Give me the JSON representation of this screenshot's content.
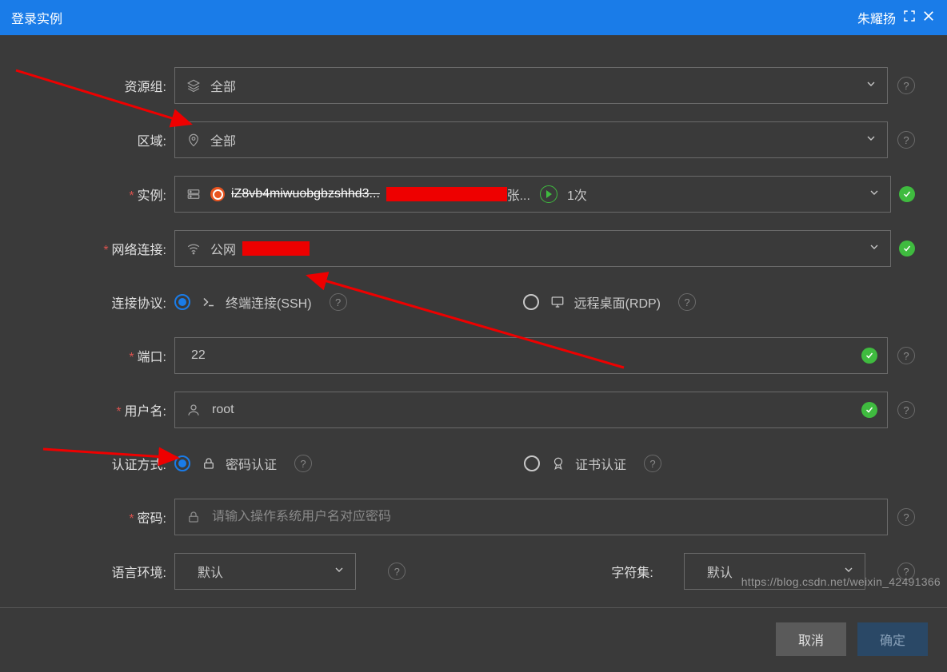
{
  "titlebar": {
    "title": "登录实例",
    "username": "朱耀扬"
  },
  "form": {
    "resource_group": {
      "label": "资源组:",
      "value": "全部"
    },
    "region": {
      "label": "区域:",
      "value": "全部"
    },
    "instance": {
      "label": "实例:",
      "text": "iZ8vb4miwuobgbzshhd3...",
      "suffix": "张...",
      "times": "1次"
    },
    "network": {
      "label": "网络连接:",
      "value": "公网"
    },
    "protocol": {
      "label": "连接协议:",
      "ssh": "终端连接(SSH)",
      "rdp": "远程桌面(RDP)"
    },
    "port": {
      "label": "端口:",
      "value": "22"
    },
    "username": {
      "label": "用户名:",
      "value": "root"
    },
    "auth": {
      "label": "认证方式:",
      "password": "密码认证",
      "cert": "证书认证"
    },
    "password": {
      "label": "密码:",
      "placeholder": "请输入操作系统用户名对应密码"
    },
    "lang": {
      "label": "语言环境:",
      "value": "默认"
    },
    "charset": {
      "label": "字符集:",
      "value": "默认"
    }
  },
  "footer": {
    "cancel": "取消",
    "ok": "确定"
  },
  "watermark": "https://blog.csdn.net/weixin_42491366"
}
